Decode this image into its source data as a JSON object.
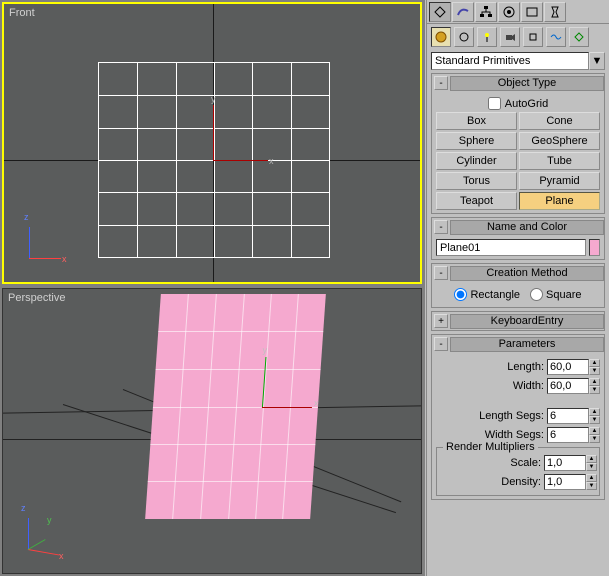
{
  "viewports": {
    "front_label": "Front",
    "perspective_label": "Perspective",
    "axes": {
      "x": "x",
      "y": "y",
      "z": "z"
    }
  },
  "panel": {
    "dropdown_value": "Standard Primitives",
    "toolbar_top": [
      "select",
      "rainbow",
      "hierarchy",
      "motion",
      "display",
      "utilities"
    ],
    "toolbar_row2": [
      "sphere",
      "compass",
      "light",
      "camera",
      "helper",
      "space",
      "systems",
      "more"
    ]
  },
  "object_type": {
    "title": "Object Type",
    "autogrid_label": "AutoGrid",
    "autogrid_checked": false,
    "buttons": [
      "Box",
      "Cone",
      "Sphere",
      "GeoSphere",
      "Cylinder",
      "Tube",
      "Torus",
      "Pyramid",
      "Teapot",
      "Plane"
    ],
    "selected": "Plane"
  },
  "name_color": {
    "title": "Name and Color",
    "value": "Plane01",
    "swatch": "#f5a9cf"
  },
  "creation_method": {
    "title": "Creation Method",
    "rectangle_label": "Rectangle",
    "square_label": "Square",
    "selected": "Rectangle"
  },
  "keyboard_entry": {
    "title": "KeyboardEntry"
  },
  "parameters": {
    "title": "Parameters",
    "length_label": "Length:",
    "length_value": "60,0",
    "width_label": "Width:",
    "width_value": "60,0",
    "length_segs_label": "Length Segs:",
    "length_segs_value": "6",
    "width_segs_label": "Width Segs:",
    "width_segs_value": "6",
    "render_multipliers_label": "Render Multipliers",
    "scale_label": "Scale:",
    "scale_value": "1,0",
    "density_label": "Density:",
    "density_value": "1,0"
  }
}
